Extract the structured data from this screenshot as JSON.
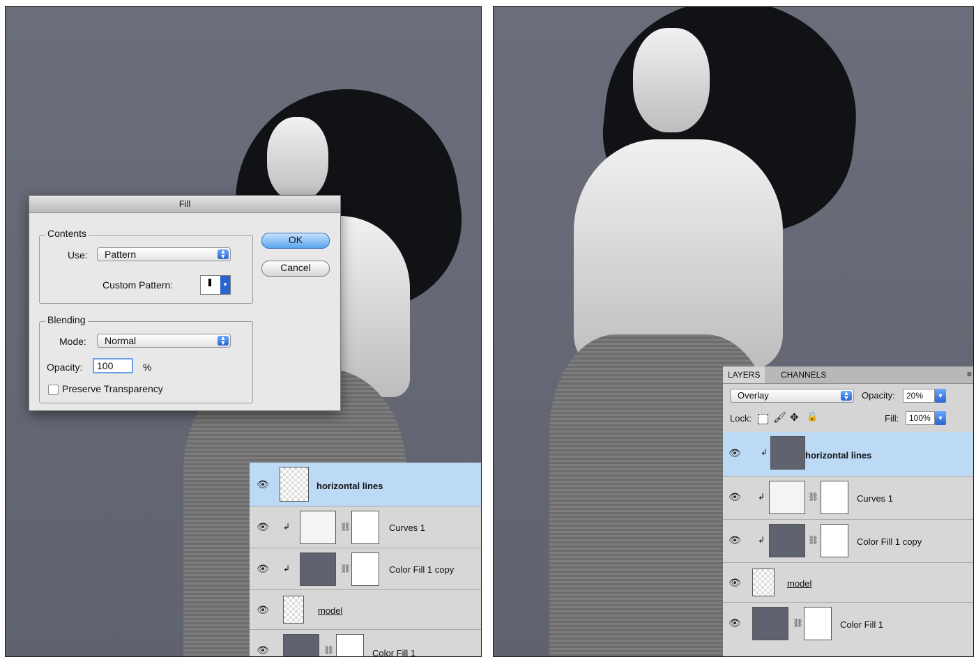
{
  "fill_dialog": {
    "title": "Fill",
    "contents_label": "Contents",
    "use_label": "Use:",
    "use_value": "Pattern",
    "custom_pattern_label": "Custom Pattern:",
    "blending_label": "Blending",
    "mode_label": "Mode:",
    "mode_value": "Normal",
    "opacity_label": "Opacity:",
    "opacity_value": "100",
    "percent_sign": "%",
    "preserve_transparency_label": "Preserve Transparency",
    "preserve_transparency_checked": false,
    "ok_label": "OK",
    "cancel_label": "Cancel"
  },
  "left_layers": [
    {
      "name": "horizontal lines",
      "selected": true
    },
    {
      "name": "Curves 1"
    },
    {
      "name": "Color Fill 1 copy"
    },
    {
      "name": "model"
    },
    {
      "name": "Color Fill 1"
    }
  ],
  "layers_panel": {
    "tab_layers": "LAYERS",
    "tab_channels": "CHANNELS",
    "blend_mode": "Overlay",
    "opacity_label": "Opacity:",
    "opacity_value": "20%",
    "lock_label": "Lock:",
    "fill_label": "Fill:",
    "fill_value": "100%",
    "layers": [
      {
        "name": "horizontal lines",
        "selected": true
      },
      {
        "name": "Curves 1"
      },
      {
        "name": "Color Fill 1 copy"
      },
      {
        "name": "model"
      },
      {
        "name": "Color Fill 1"
      }
    ]
  },
  "colors": {
    "canvas_bg": "#646774",
    "selected_row": "#bcd9f6",
    "accent_blue": "#2a63cf"
  },
  "icons": [
    "eye-icon",
    "checkerboard-thumbnail",
    "curves-thumbnail",
    "link-chain-icon",
    "clip-arrow-icon",
    "lock-transparent-icon",
    "brush-icon",
    "move-icon",
    "lock-icon",
    "panel-menu-icon"
  ]
}
